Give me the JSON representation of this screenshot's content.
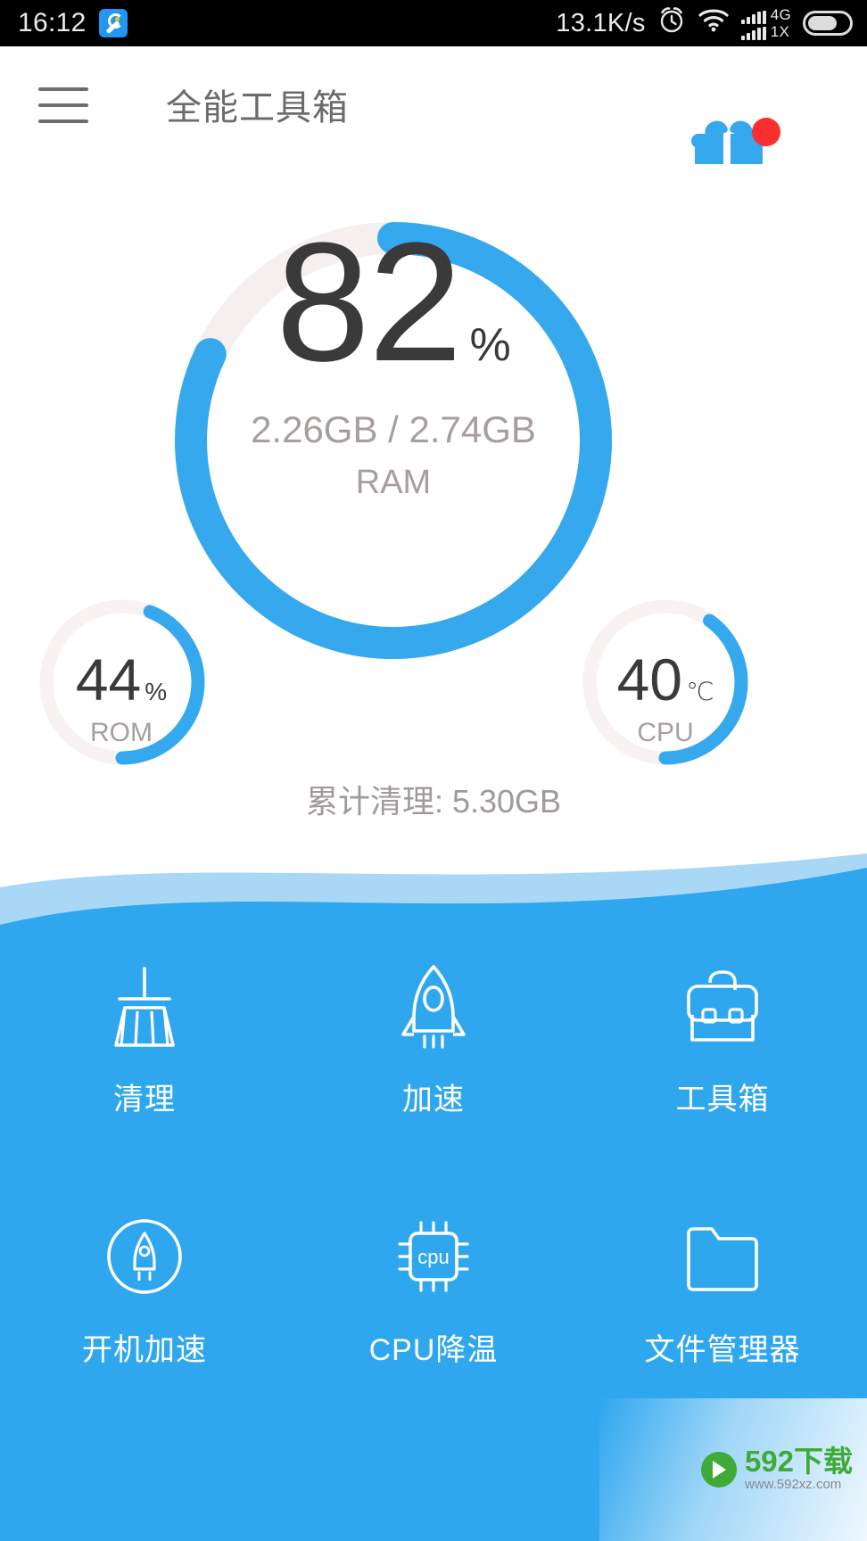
{
  "status_bar": {
    "time": "16:12",
    "tool_icon": "wrench-icon",
    "network_speed": "13.1K/s",
    "alarm_icon": "alarm-clock-icon",
    "wifi_icon": "wifi-icon",
    "signal_icon": "signal-bars-icon",
    "network_type_primary": "4G",
    "network_type_secondary": "1X",
    "battery_icon": "battery-icon"
  },
  "app_bar": {
    "menu_icon": "hamburger-menu-icon",
    "title": "全能工具箱",
    "gift_icon": "gift-icon",
    "gift_has_badge": true
  },
  "gauges": {
    "main": {
      "value": "82",
      "unit": "%",
      "detail": "2.26GB / 2.74GB",
      "label": "RAM",
      "percent": 82,
      "ring_color": "#35a8ee",
      "track_color": "#f5eeee"
    },
    "left": {
      "value": "44",
      "unit": "%",
      "label": "ROM",
      "percent": 44,
      "ring_color": "#35a8ee",
      "track_color": "#f7f1f1"
    },
    "right": {
      "value": "40",
      "unit": "℃",
      "label": "CPU",
      "percent": 40,
      "ring_color": "#35a8ee",
      "track_color": "#f7f1f1"
    },
    "cleaned_total": "累计清理: 5.30GB"
  },
  "tools": {
    "background_color": "#2fa7ef",
    "wave_color": "#a9d8f7",
    "items": [
      {
        "label": "清理",
        "icon": "broom-icon"
      },
      {
        "label": "加速",
        "icon": "rocket-icon"
      },
      {
        "label": "工具箱",
        "icon": "briefcase-icon"
      },
      {
        "label": "开机加速",
        "icon": "boot-speed-rocket-icon"
      },
      {
        "label": "CPU降温",
        "icon": "cpu-chip-icon"
      },
      {
        "label": "文件管理器",
        "icon": "folder-icon"
      }
    ]
  },
  "watermark": {
    "brand": "592下载",
    "url": "www.592xz.com",
    "badge_icon": "play-badge-icon",
    "color": "#3faa36"
  }
}
